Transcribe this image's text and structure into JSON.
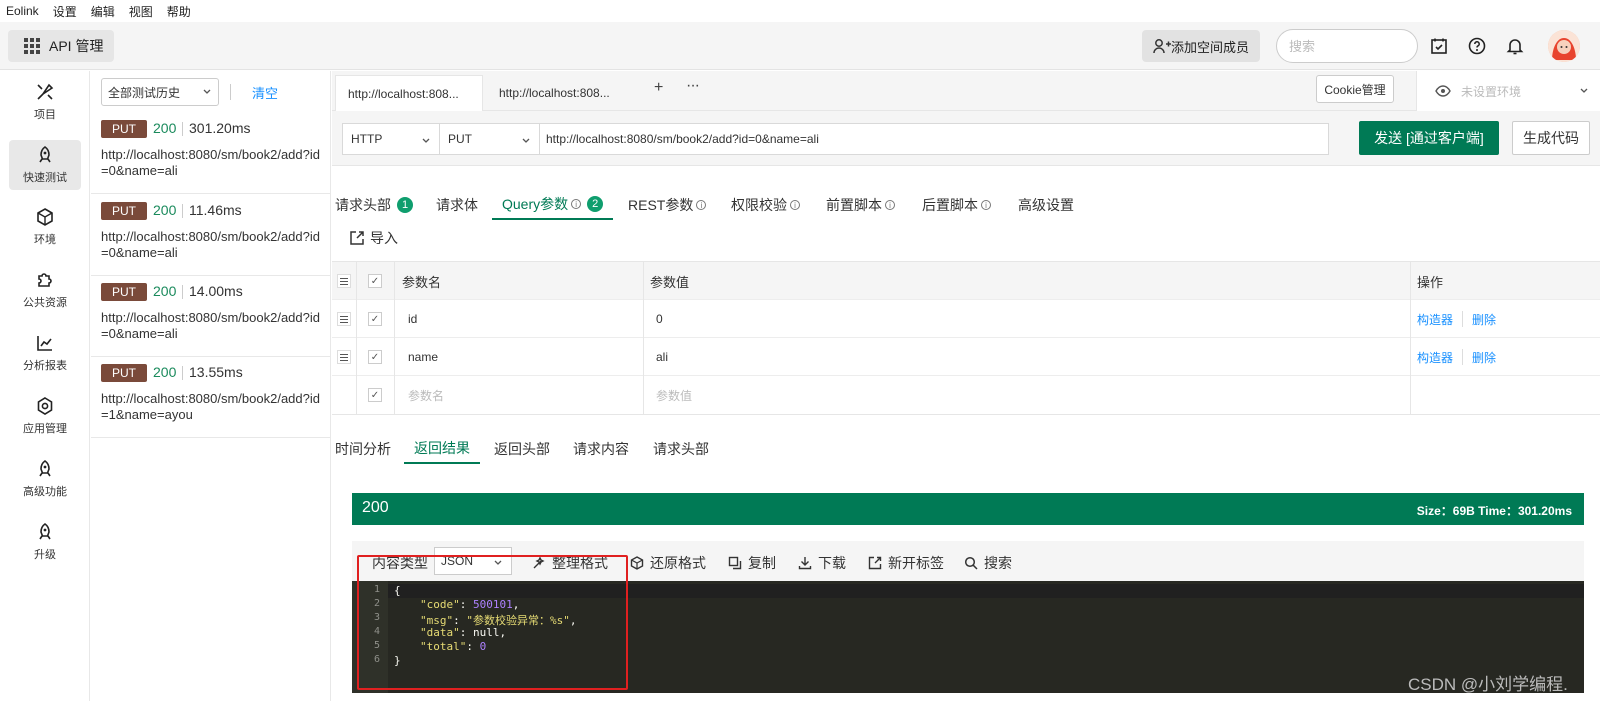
{
  "menubar": {
    "items": [
      "Eolink",
      "设置",
      "编辑",
      "视图",
      "帮助"
    ]
  },
  "topbar": {
    "api_label": "API 管理",
    "add_member_label": "添加空间成员",
    "search_placeholder": "搜索"
  },
  "leftnav": {
    "items": [
      {
        "label": "项目",
        "icon": "brush-icon"
      },
      {
        "label": "快速测试",
        "icon": "rocket-icon"
      },
      {
        "label": "环境",
        "icon": "cube-icon"
      },
      {
        "label": "公共资源",
        "icon": "puzzle-icon"
      },
      {
        "label": "分析报表",
        "icon": "chart-icon"
      },
      {
        "label": "应用管理",
        "icon": "gear-icon"
      },
      {
        "label": "高级功能",
        "icon": "rocket-icon"
      },
      {
        "label": "升级",
        "icon": "rocket-icon"
      }
    ],
    "active": "快速测试"
  },
  "history": {
    "filter": "全部测试历史",
    "clear_label": "清空",
    "items": [
      {
        "method": "PUT",
        "status": "200",
        "time": "301.20ms",
        "url": "http://localhost:8080/sm/book2/add?id=0&name=ali"
      },
      {
        "method": "PUT",
        "status": "200",
        "time": "11.46ms",
        "url": "http://localhost:8080/sm/book2/add?id=0&name=ali"
      },
      {
        "method": "PUT",
        "status": "200",
        "time": "14.00ms",
        "url": "http://localhost:8080/sm/book2/add?id=0&name=ali"
      },
      {
        "method": "PUT",
        "status": "200",
        "time": "13.55ms",
        "url": "http://localhost:8080/sm/book2/add?id=1&name=ayou"
      }
    ]
  },
  "request_tabs": [
    {
      "label": "http://localhost:808..."
    },
    {
      "label": "http://localhost:808..."
    }
  ],
  "cookie_label": "Cookie管理",
  "env_label": "未设置环境",
  "request": {
    "protocol": "HTTP",
    "method": "PUT",
    "url": "http://localhost:8080/sm/book2/add?id=0&name=ali",
    "send_label": "发送 [通过客户端]",
    "gen_code_label": "生成代码"
  },
  "param_tabs": [
    {
      "label": "请求头部",
      "badge": "1"
    },
    {
      "label": "请求体"
    },
    {
      "label": "Query参数",
      "badge": "2"
    },
    {
      "label": "REST参数"
    },
    {
      "label": "权限校验"
    },
    {
      "label": "前置脚本"
    },
    {
      "label": "后置脚本"
    },
    {
      "label": "高级设置"
    }
  ],
  "import_label": "导入",
  "param_table": {
    "headers": {
      "name": "参数名",
      "value": "参数值",
      "ops": "操作"
    },
    "rows": [
      {
        "name": "id",
        "value": "0",
        "builder": "构造器",
        "delete": "删除"
      },
      {
        "name": "name",
        "value": "ali",
        "builder": "构造器",
        "delete": "删除"
      }
    ],
    "placeholder_name": "参数名",
    "placeholder_value": "参数值"
  },
  "response_tabs": [
    "时间分析",
    "返回结果",
    "返回头部",
    "请求内容",
    "请求头部"
  ],
  "response": {
    "status": "200",
    "meta": "Size：69B    Time：301.20ms",
    "content_type_label": "内容类型",
    "content_type": "JSON",
    "toolbar": [
      "整理格式",
      "还原格式",
      "复制",
      "下载",
      "新开标签",
      "搜索"
    ],
    "code_lines": [
      "{",
      "\"code\": 500101,",
      "\"msg\": \"参数校验异常：%s\",",
      "\"data\": null,",
      "\"total\": 0",
      "}"
    ]
  },
  "watermark": "CSDN @小刘学编程."
}
